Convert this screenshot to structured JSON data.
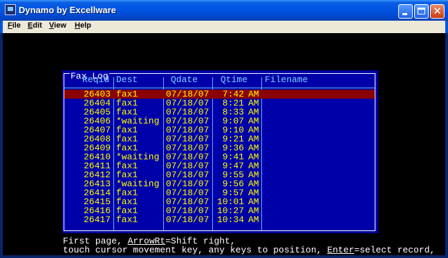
{
  "window": {
    "title": "Dynamo by Excellware"
  },
  "menu": {
    "items": [
      "File",
      "Edit",
      "View",
      "Help"
    ]
  },
  "faxlog": {
    "title": "Fax Log",
    "headers": {
      "reqid": "Reqid",
      "dest": "Dest",
      "qdate": "Qdate",
      "qtime": "Qtime",
      "filename": "Filename"
    },
    "rows": [
      {
        "reqid": "26403",
        "dest": "fax1",
        "qdate": "07/18/07",
        "qtime": "7:42",
        "ampm": "AM",
        "filename": ""
      },
      {
        "reqid": "26404",
        "dest": "fax1",
        "qdate": "07/18/07",
        "qtime": "8:21",
        "ampm": "AM",
        "filename": ""
      },
      {
        "reqid": "26405",
        "dest": "fax1",
        "qdate": "07/18/07",
        "qtime": "8:33",
        "ampm": "AM",
        "filename": ""
      },
      {
        "reqid": "26406",
        "dest": "*waiting",
        "qdate": "07/18/07",
        "qtime": "9:07",
        "ampm": "AM",
        "filename": ""
      },
      {
        "reqid": "26407",
        "dest": "fax1",
        "qdate": "07/18/07",
        "qtime": "9:10",
        "ampm": "AM",
        "filename": ""
      },
      {
        "reqid": "26408",
        "dest": "fax1",
        "qdate": "07/18/07",
        "qtime": "9:21",
        "ampm": "AM",
        "filename": ""
      },
      {
        "reqid": "26409",
        "dest": "fax1",
        "qdate": "07/18/07",
        "qtime": "9:36",
        "ampm": "AM",
        "filename": ""
      },
      {
        "reqid": "26410",
        "dest": "*waiting",
        "qdate": "07/18/07",
        "qtime": "9:41",
        "ampm": "AM",
        "filename": ""
      },
      {
        "reqid": "26411",
        "dest": "fax1",
        "qdate": "07/18/07",
        "qtime": "9:47",
        "ampm": "AM",
        "filename": ""
      },
      {
        "reqid": "26412",
        "dest": "fax1",
        "qdate": "07/18/07",
        "qtime": "9:55",
        "ampm": "AM",
        "filename": ""
      },
      {
        "reqid": "26413",
        "dest": "*waiting",
        "qdate": "07/18/07",
        "qtime": "9:56",
        "ampm": "AM",
        "filename": ""
      },
      {
        "reqid": "26414",
        "dest": "fax1",
        "qdate": "07/18/07",
        "qtime": "9:57",
        "ampm": "AM",
        "filename": ""
      },
      {
        "reqid": "26415",
        "dest": "fax1",
        "qdate": "07/18/07",
        "qtime": "10:01",
        "ampm": "AM",
        "filename": ""
      },
      {
        "reqid": "26416",
        "dest": "fax1",
        "qdate": "07/18/07",
        "qtime": "10:27",
        "ampm": "AM",
        "filename": ""
      },
      {
        "reqid": "26417",
        "dest": "fax1",
        "qdate": "07/18/07",
        "qtime": "10:34",
        "ampm": "AM",
        "filename": ""
      }
    ],
    "selected_reqid": "26403"
  },
  "help": {
    "line1": {
      "a": "First page, ",
      "k1": "ArrowRt",
      "b": "=Shift right,"
    },
    "line2": {
      "a": "touch cursor movement key, any keys to position, ",
      "k1": "Enter",
      "b": "=select record,"
    }
  },
  "colors": {
    "screen": "#000000",
    "panel": "#0000a8",
    "data_text": "#ffff00",
    "header_text": "#7fd0ff",
    "selected_row": "#8b0000"
  }
}
